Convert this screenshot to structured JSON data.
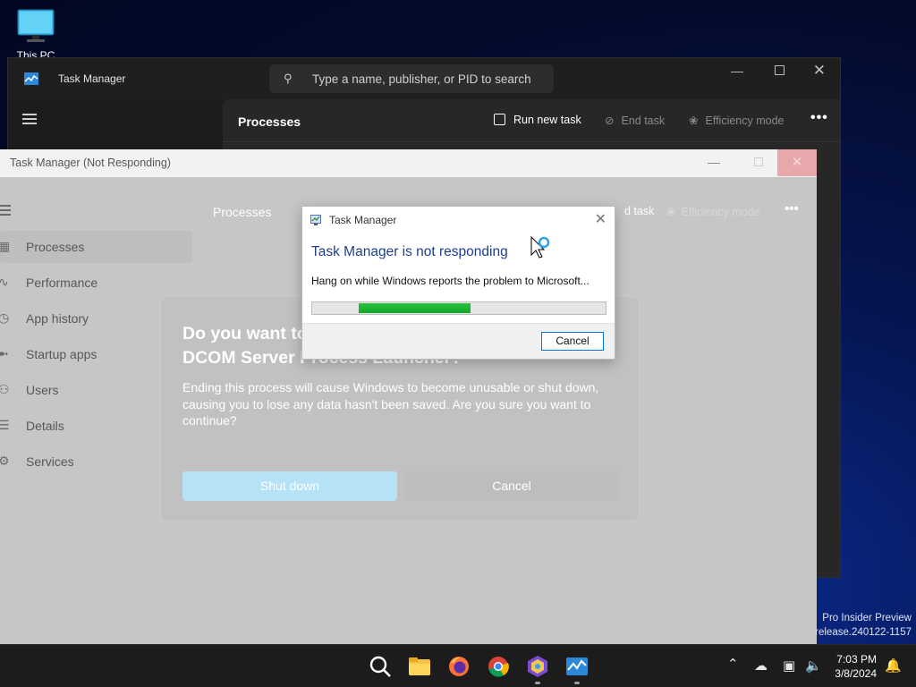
{
  "desktop": {
    "icon_label": "This PC"
  },
  "tm_dark": {
    "title": "Task Manager",
    "search_placeholder": "Type a name, publisher, or PID to search",
    "heading": "Processes",
    "run_new_task": "Run new task",
    "end_task": "End task",
    "efficiency_mode": "Efficiency mode"
  },
  "tm_light": {
    "title": "Task Manager (Not Responding)",
    "heading": "Processes",
    "end_task_partial": "d task",
    "efficiency_mode": "Efficiency mode",
    "nav": [
      {
        "label": "Processes"
      },
      {
        "label": "Performance"
      },
      {
        "label": "App history"
      },
      {
        "label": "Startup apps"
      },
      {
        "label": "Users"
      },
      {
        "label": "Details"
      },
      {
        "label": "Services"
      }
    ]
  },
  "confirm": {
    "title_line1": "Do you want to",
    "title_line2": "DCOM Server Process Launcher?",
    "body": "Ending this process will cause Windows to become unusable or shut down, causing you to lose any data hasn't been saved. Are you sure you want to continue?",
    "shutdown_label": "Shut down",
    "cancel_label": "Cancel"
  },
  "dialog": {
    "caption": "Task Manager",
    "headline": "Task Manager is not responding",
    "message": "Hang on while Windows reports the problem to Microsoft...",
    "progress_start": 0.16,
    "progress_end": 0.54,
    "cancel_label": "Cancel"
  },
  "watermark": {
    "line1": "Pro Insider Preview",
    "line2": "release.240122-1157"
  },
  "taskbar": {
    "time": "7:03 PM",
    "date": "3/8/2024",
    "apps": [
      "search-icon",
      "file-explorer-icon",
      "firefox-icon",
      "chrome-icon",
      "app-icon",
      "task-manager-icon"
    ]
  },
  "colors": {
    "accent": "#0078d7",
    "progress": "#16b530",
    "close_hover": "#e8a7ab"
  }
}
